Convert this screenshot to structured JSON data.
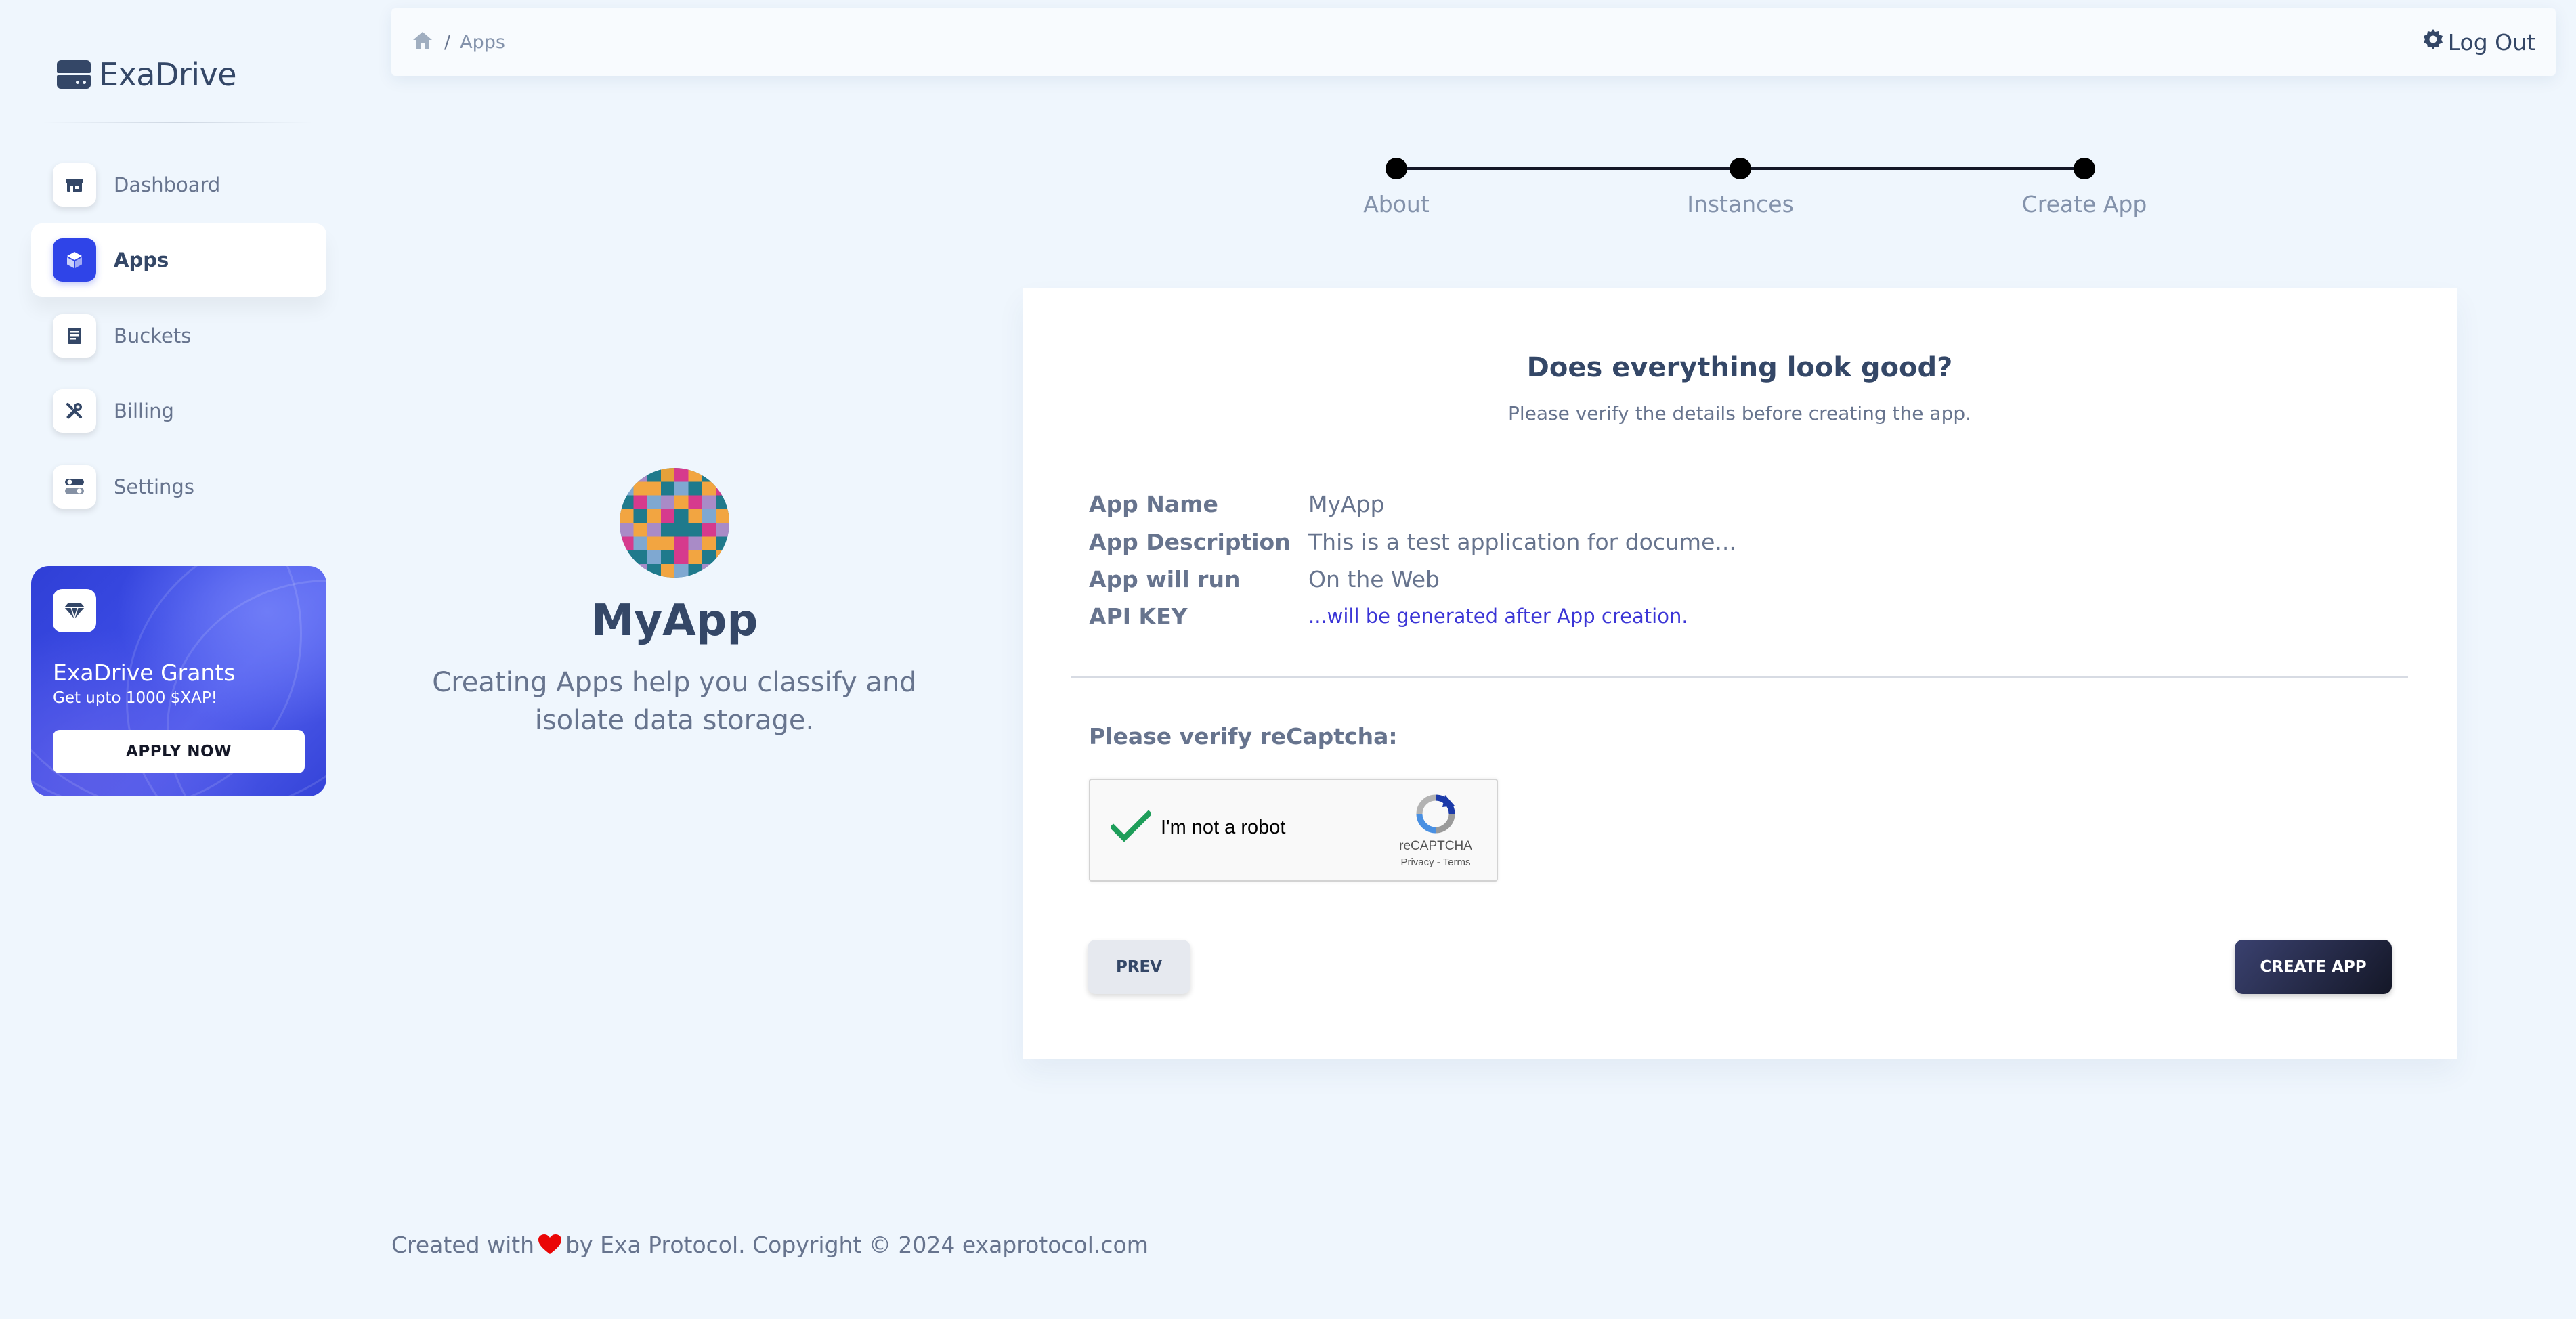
{
  "brand": {
    "name": "ExaDrive"
  },
  "sidebar": {
    "items": [
      {
        "label": "Dashboard",
        "icon": "shop-icon"
      },
      {
        "label": "Apps",
        "icon": "cube-icon",
        "active": true
      },
      {
        "label": "Buckets",
        "icon": "document-icon"
      },
      {
        "label": "Billing",
        "icon": "tools-icon"
      },
      {
        "label": "Settings",
        "icon": "switches-icon"
      }
    ],
    "grant": {
      "icon": "diamond-icon",
      "title": "ExaDrive Grants",
      "subtitle": "Get upto 1000 $XAP!",
      "button": "APPLY NOW"
    }
  },
  "topbar": {
    "breadcrumb": {
      "home_icon": "home-icon",
      "separator": "/",
      "current": "Apps"
    },
    "logout_label": "Log Out",
    "logout_icon": "gear-icon"
  },
  "stepper": {
    "steps": [
      "About",
      "Instances",
      "Create App"
    ],
    "current_index": 2
  },
  "app_preview": {
    "name": "MyApp",
    "description": "Creating Apps help you classify and isolate data storage."
  },
  "review": {
    "title": "Does everything look good?",
    "subtitle": "Please verify the details before creating the app.",
    "details": [
      {
        "key": "App Name",
        "value": "MyApp"
      },
      {
        "key": "App Description",
        "value": "This is a test application for docume..."
      },
      {
        "key": "App will run",
        "value": "On the Web"
      },
      {
        "key": "API KEY",
        "value": "...will be generated after App creation."
      }
    ],
    "verify_label": "Please verify reCaptcha:",
    "recaptcha": {
      "label": "I'm not a robot",
      "brand": "reCAPTCHA",
      "privacy": "Privacy",
      "sep": " - ",
      "terms": "Terms",
      "checked": true
    },
    "prev_label": "PREV",
    "create_label": "CREATE APP"
  },
  "footer": {
    "before": "Created with",
    "after": "by Exa Protocol. Copyright © 2024 exaprotocol.com"
  },
  "colors": {
    "background": "#eff6fd",
    "primary_text": "#344767",
    "secondary_text": "#67748e",
    "accent": "#2f44e8",
    "link": "#3b35d6",
    "heart": "#ea0606",
    "dark_button": "#141727"
  }
}
